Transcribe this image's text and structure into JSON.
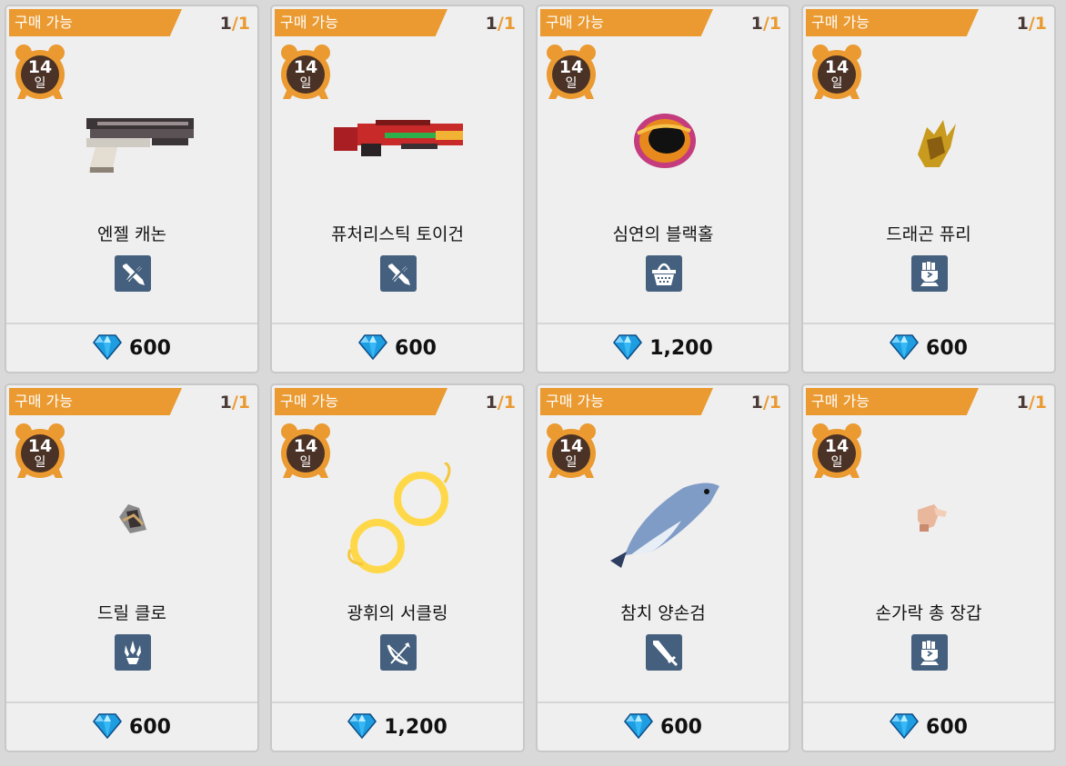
{
  "colors": {
    "tag": "#ea9a30",
    "type_icon_bg": "#45607e",
    "card_bg": "#efefef",
    "timer": "#6a4632"
  },
  "items": [
    {
      "status": "구매 가능",
      "count_current": "1",
      "count_sep": "/",
      "count_max": "1",
      "days": "14",
      "days_unit": "일",
      "name": "엔젤 캐논",
      "type_icon": "gun-icon",
      "art": "pistol-art",
      "currency_icon": "diamond-icon",
      "price": "600"
    },
    {
      "status": "구매 가능",
      "count_current": "1",
      "count_sep": "/",
      "count_max": "1",
      "days": "14",
      "days_unit": "일",
      "name": "퓨처리스틱 토이건",
      "type_icon": "gun-icon",
      "art": "rifle-art",
      "currency_icon": "diamond-icon",
      "price": "600"
    },
    {
      "status": "구매 가능",
      "count_current": "1",
      "count_sep": "/",
      "count_max": "1",
      "days": "14",
      "days_unit": "일",
      "name": "심연의 블랙홀",
      "type_icon": "basket-icon",
      "art": "blackhole-art",
      "currency_icon": "diamond-icon",
      "price": "1,200"
    },
    {
      "status": "구매 가능",
      "count_current": "1",
      "count_sep": "/",
      "count_max": "1",
      "days": "14",
      "days_unit": "일",
      "name": "드래곤 퓨리",
      "type_icon": "fist-icon",
      "art": "dragon-claw-art",
      "currency_icon": "diamond-icon",
      "price": "600"
    },
    {
      "status": "구매 가능",
      "count_current": "1",
      "count_sep": "/",
      "count_max": "1",
      "days": "14",
      "days_unit": "일",
      "name": "드릴 클로",
      "type_icon": "claw-icon",
      "art": "drill-art",
      "currency_icon": "diamond-icon",
      "price": "600"
    },
    {
      "status": "구매 가능",
      "count_current": "1",
      "count_sep": "/",
      "count_max": "1",
      "days": "14",
      "days_unit": "일",
      "name": "광휘의 서클링",
      "type_icon": "bow-icon",
      "art": "ring-art",
      "currency_icon": "diamond-icon",
      "price": "1,200"
    },
    {
      "status": "구매 가능",
      "count_current": "1",
      "count_sep": "/",
      "count_max": "1",
      "days": "14",
      "days_unit": "일",
      "name": "참치 양손검",
      "type_icon": "sword-icon",
      "art": "tuna-art",
      "currency_icon": "diamond-icon",
      "price": "600"
    },
    {
      "status": "구매 가능",
      "count_current": "1",
      "count_sep": "/",
      "count_max": "1",
      "days": "14",
      "days_unit": "일",
      "name": "손가락 총 장갑",
      "type_icon": "fist-icon",
      "art": "finger-glove-art",
      "currency_icon": "diamond-icon",
      "price": "600"
    }
  ]
}
